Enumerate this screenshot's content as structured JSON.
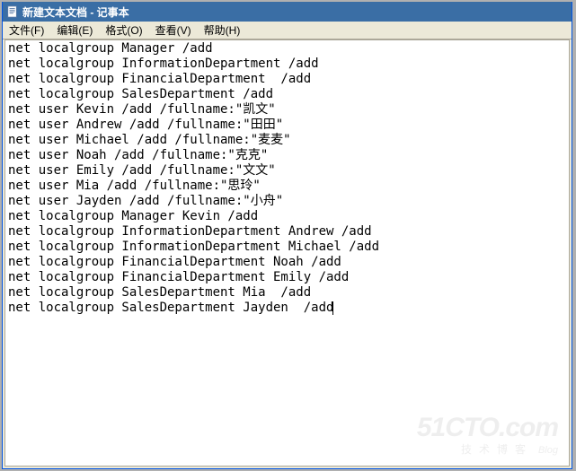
{
  "window": {
    "title": "新建文本文档 - 记事本"
  },
  "menu": {
    "file": "文件(F)",
    "edit": "编辑(E)",
    "format": "格式(O)",
    "view": "查看(V)",
    "help": "帮助(H)"
  },
  "content_lines": [
    "net localgroup Manager /add",
    "net localgroup InformationDepartment /add",
    "net localgroup FinancialDepartment  /add",
    "net localgroup SalesDepartment /add",
    "net user Kevin /add /fullname:\"凯文\"",
    "net user Andrew /add /fullname:\"田田\"",
    "net user Michael /add /fullname:\"麦麦\"",
    "net user Noah /add /fullname:\"克克\"",
    "net user Emily /add /fullname:\"文文\"",
    "net user Mia /add /fullname:\"思玲\"",
    "net user Jayden /add /fullname:\"小舟\"",
    "net localgroup Manager Kevin /add",
    "net localgroup InformationDepartment Andrew /add",
    "net localgroup InformationDepartment Michael /add",
    "net localgroup FinancialDepartment Noah /add",
    "net localgroup FinancialDepartment Emily /add",
    "net localgroup SalesDepartment Mia  /add",
    "net localgroup SalesDepartment Jayden  /add"
  ],
  "watermark": {
    "main": "51CTO.com",
    "sub": "技术博客",
    "blog": "Blog"
  }
}
